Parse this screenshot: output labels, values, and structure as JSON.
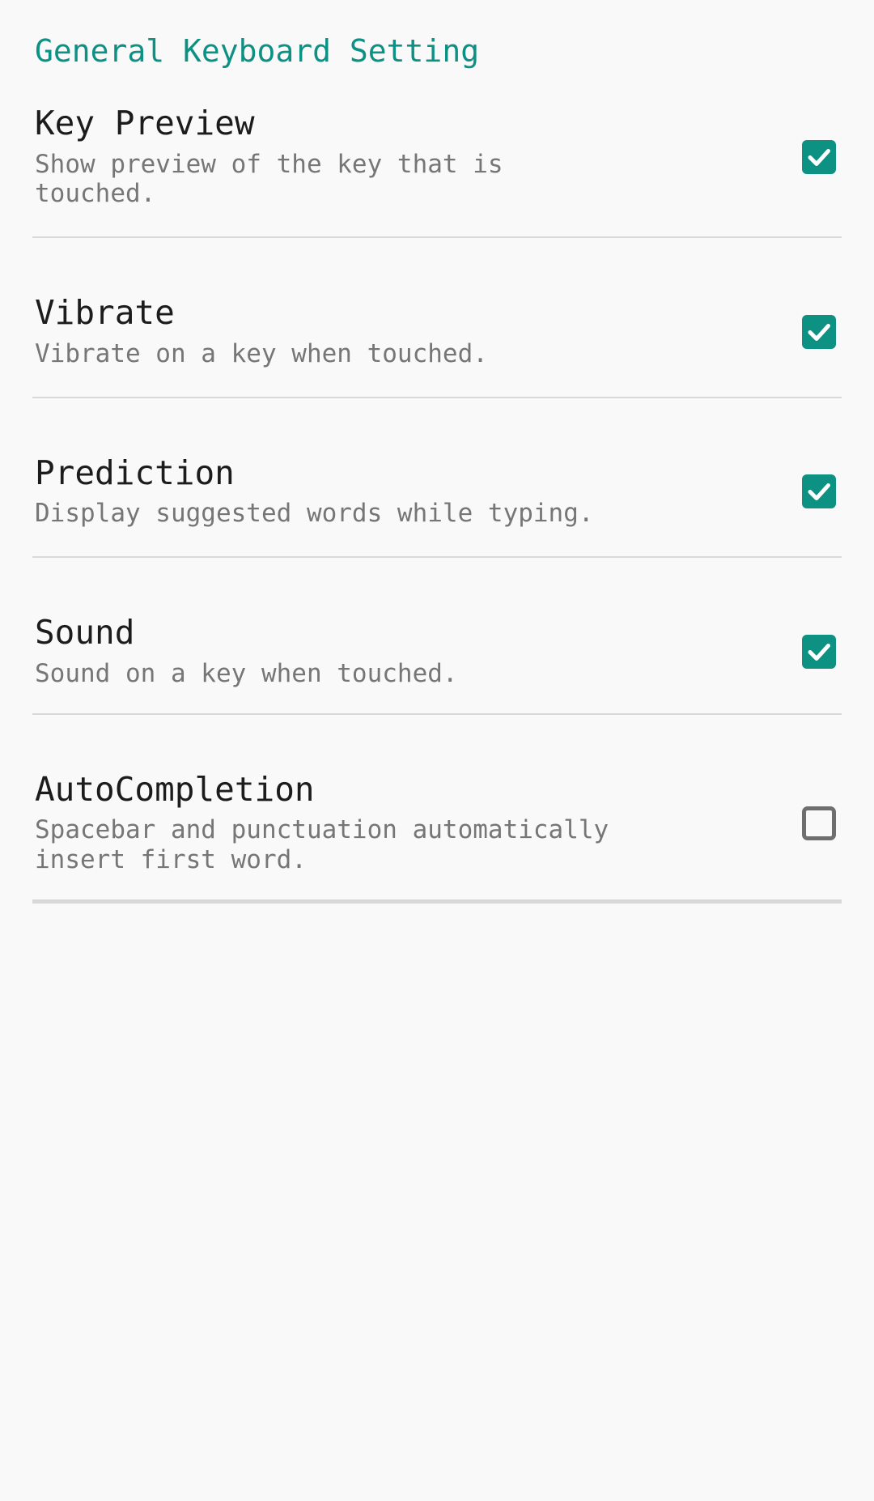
{
  "screen": {
    "background_color": "#f9f9f9",
    "accent_color": "#0c9183",
    "title_color": "#1c1c1c",
    "summary_color": "#767676",
    "divider_color": "#d9d9d9"
  },
  "section": {
    "header": "General Keyboard Setting"
  },
  "preferences": [
    {
      "key": "key_preview",
      "title": "Key Preview",
      "summary": "Show preview of the key that is touched.",
      "checked": true,
      "checkbox_state": "checked"
    },
    {
      "key": "vibrate",
      "title": "Vibrate",
      "summary": "Vibrate on a key when touched.",
      "checked": true,
      "checkbox_state": "checked"
    },
    {
      "key": "prediction",
      "title": "Prediction",
      "summary": "Display suggested words while typing.",
      "checked": true,
      "checkbox_state": "checked"
    },
    {
      "key": "sound",
      "title": "Sound",
      "summary": "Sound on a key when touched.",
      "checked": true,
      "checkbox_state": "checked"
    },
    {
      "key": "autocompletion",
      "title": "AutoCompletion",
      "summary": "Spacebar and punctuation automatically insert first word.",
      "checked": false,
      "checkbox_state": "unchecked"
    }
  ]
}
